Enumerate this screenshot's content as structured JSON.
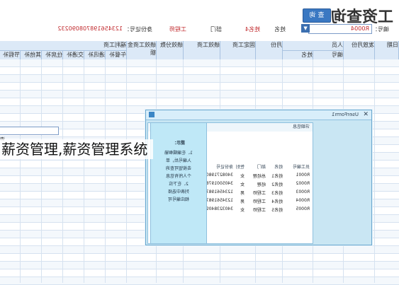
{
  "header": {
    "title": "工资查询",
    "query_button": "查 询",
    "labels": {
      "emp_id": "编号：",
      "name": "姓名",
      "dept": "部门",
      "position": "工程师",
      "id_card": "身份证号："
    },
    "values": {
      "emp_id": "R0004",
      "name": "姓名4",
      "id_card": "123456198708090232"
    }
  },
  "table": {
    "columns_top": [
      "日期",
      "发放月份",
      "人员",
      "月份",
      "固定工资",
      "绩效工资",
      "绩效分数",
      "绩效工资金额",
      "福利工资",
      "",
      "",
      "",
      "",
      "扣款项目"
    ],
    "columns_sub": [
      "编号",
      "姓名",
      "午餐补贴",
      "通讯补贴",
      "交通补贴",
      "住房补贴",
      "其他补贴",
      "节假补贴"
    ],
    "row_count": 29
  },
  "dialog": {
    "title": "UserForm1",
    "detail_tab": "详细信息",
    "search_label": "请输入编号",
    "panel_title": "提示：",
    "panel_lines": [
      "1、在编辑框输",
      "入编号后，单",
      "击按钮可查询",
      "个人所有信息",
      "2、在下拉",
      "列表中选择",
      "相应编号可"
    ],
    "record_headers": [
      "员工编号",
      "姓名",
      "部门",
      "性别",
      "身份证号"
    ],
    "records": [
      [
        "R0001",
        "姓名1",
        "总经理",
        "女",
        "34082719801218940X"
      ],
      [
        "R0002",
        "姓名2",
        "经理",
        "女",
        "34050019780406052X"
      ],
      [
        "R0003",
        "姓名3",
        "工程师",
        "男",
        "123456198708090232"
      ],
      [
        "R0004",
        "姓名4",
        "工程师",
        "男",
        "123456198708090232"
      ],
      [
        "R0005",
        "姓名5",
        "工程师",
        "女",
        "340323840916365"
      ]
    ]
  },
  "caption": "薪资管理,薪资管理系统",
  "colors": {
    "header_bg": "#dce9f7",
    "accent": "#3a78c2",
    "dialog_bg": "#c9e6f3",
    "red_text": "#c0282c"
  }
}
